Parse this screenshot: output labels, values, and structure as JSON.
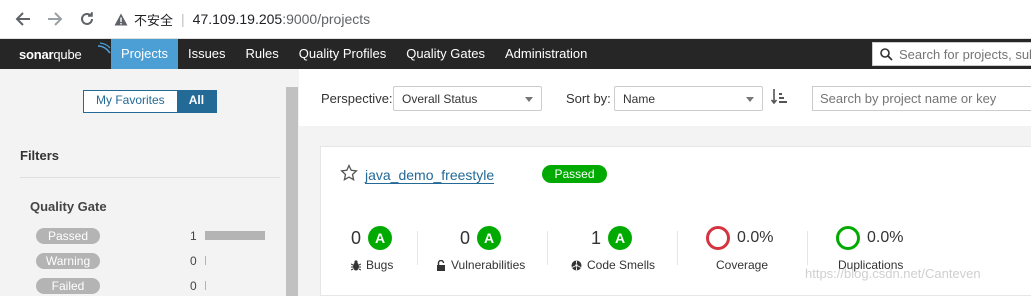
{
  "browser": {
    "insecure_label": "不安全",
    "url_host": "47.109.19.205",
    "url_rest": ":9000/projects"
  },
  "nav": {
    "logo_bold": "sonar",
    "logo_thin": "qube",
    "items": [
      {
        "label": "Projects",
        "active": true
      },
      {
        "label": "Issues"
      },
      {
        "label": "Rules"
      },
      {
        "label": "Quality Profiles"
      },
      {
        "label": "Quality Gates"
      },
      {
        "label": "Administration"
      }
    ],
    "search_placeholder": "Search for projects, sub"
  },
  "sidebar": {
    "toggle": {
      "my_favorites": "My Favorites",
      "all": "All",
      "selected": "All"
    },
    "filters_title": "Filters",
    "quality_gate_title": "Quality Gate",
    "quality_gate": [
      {
        "label": "Passed",
        "count": "1",
        "fraction": 1.0
      },
      {
        "label": "Warning",
        "count": "0",
        "fraction": 0
      },
      {
        "label": "Failed",
        "count": "0",
        "fraction": 0
      }
    ]
  },
  "toolbar": {
    "perspective_label": "Perspective:",
    "perspective_value": "Overall Status",
    "sortby_label": "Sort by:",
    "sortby_value": "Name",
    "search_placeholder": "Search by project name or key"
  },
  "project": {
    "name": "java_demo_freestyle",
    "status": "Passed",
    "status_color": "#00aa00",
    "measures": {
      "bugs": {
        "value": "0",
        "rating": "A",
        "label": "Bugs"
      },
      "vulnerabilities": {
        "value": "0",
        "rating": "A",
        "label": "Vulnerabilities"
      },
      "code_smells": {
        "value": "1",
        "rating": "A",
        "label": "Code Smells"
      },
      "coverage": {
        "value": "0.0%",
        "label": "Coverage",
        "color": "#d4333f"
      },
      "duplications": {
        "value": "0.0%",
        "label": "Duplications",
        "color": "#00aa00"
      }
    }
  },
  "watermark": "https://blog.csdn.net/Canteven"
}
